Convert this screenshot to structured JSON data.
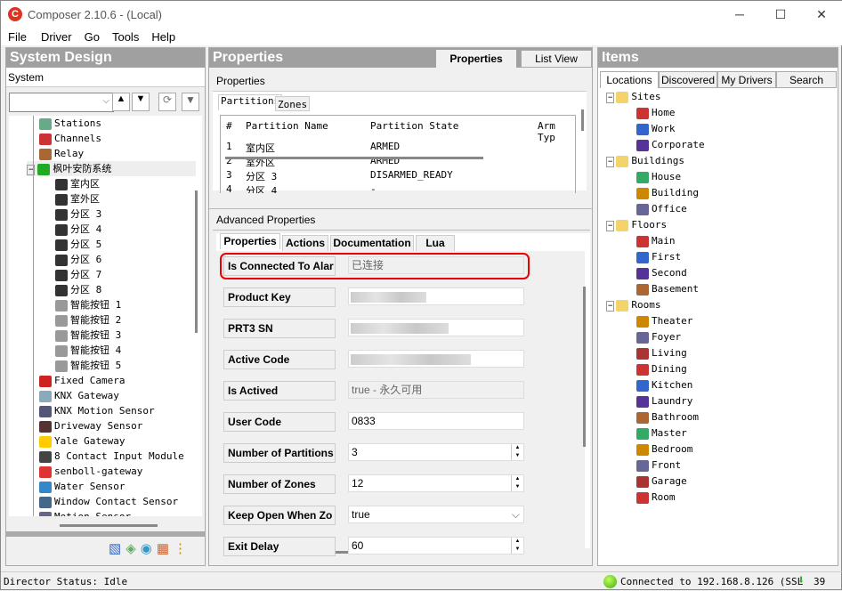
{
  "window": {
    "title": "Composer 2.10.6 - (Local)",
    "minimize": "─",
    "maximize": "☐",
    "close": "✕"
  },
  "menu": [
    "File",
    "Driver",
    "Go",
    "Tools",
    "Help"
  ],
  "left": {
    "title": "System Design",
    "subtitle": "System",
    "tree": [
      {
        "label": "Stations",
        "icon": "stations-icon",
        "color": "#6a8"
      },
      {
        "label": "Channels",
        "icon": "channels-icon",
        "color": "#c33"
      },
      {
        "label": "Relay",
        "icon": "relay-icon",
        "color": "#a63"
      },
      {
        "label": "枫叶安防系统",
        "icon": "panel-icon",
        "color": "#2a2"
      },
      {
        "label": "室内区",
        "icon": "partition-icon",
        "color": "#333"
      },
      {
        "label": "室外区",
        "icon": "partition-icon",
        "color": "#333"
      },
      {
        "label": "分区 3",
        "icon": "partition-icon",
        "color": "#333"
      },
      {
        "label": "分区 4",
        "icon": "partition-icon",
        "color": "#333"
      },
      {
        "label": "分区 5",
        "icon": "partition-icon",
        "color": "#333"
      },
      {
        "label": "分区 6",
        "icon": "partition-icon",
        "color": "#333"
      },
      {
        "label": "分区 7",
        "icon": "partition-icon",
        "color": "#333"
      },
      {
        "label": "分区 8",
        "icon": "partition-icon",
        "color": "#333"
      },
      {
        "label": "智能按钮 1",
        "icon": "button-icon",
        "color": "#999"
      },
      {
        "label": "智能按钮 2",
        "icon": "button-icon",
        "color": "#999"
      },
      {
        "label": "智能按钮 3",
        "icon": "button-icon",
        "color": "#999"
      },
      {
        "label": "智能按钮 4",
        "icon": "button-icon",
        "color": "#999"
      },
      {
        "label": "智能按钮 5",
        "icon": "button-icon",
        "color": "#999"
      },
      {
        "label": "Fixed Camera",
        "icon": "camera-icon",
        "color": "#c22"
      },
      {
        "label": "KNX Gateway",
        "icon": "knx-icon",
        "color": "#8ab"
      },
      {
        "label": "KNX Motion Sensor",
        "icon": "sensor-icon",
        "color": "#557"
      },
      {
        "label": "Driveway Sensor",
        "icon": "sensor-icon",
        "color": "#533"
      },
      {
        "label": "Yale Gateway",
        "icon": "yale-icon",
        "color": "#fc0"
      },
      {
        "label": "8 Contact Input Module",
        "icon": "module-icon",
        "color": "#444"
      },
      {
        "label": "senboll-gateway",
        "icon": "gateway-icon",
        "color": "#d33"
      },
      {
        "label": "Water Sensor",
        "icon": "water-icon",
        "color": "#38c"
      },
      {
        "label": "Window Contact Sensor",
        "icon": "window-icon",
        "color": "#468"
      },
      {
        "label": "Motion Sensor",
        "icon": "sensor-icon",
        "color": "#668"
      }
    ]
  },
  "middle": {
    "title": "Properties",
    "tabs": [
      "Properties",
      "List View"
    ],
    "section": "Properties",
    "subtabs": [
      "Partitions",
      "Zones"
    ],
    "columns": [
      "#",
      "Partition Name",
      "Partition State",
      "Arm Typ"
    ],
    "rows": [
      [
        "1",
        "室内区",
        "ARMED"
      ],
      [
        "2",
        "室外区",
        "ARMED"
      ],
      [
        "3",
        "分区 3",
        "DISARMED_READY"
      ],
      [
        "4",
        "分区 4",
        "-"
      ]
    ],
    "advanced": "Advanced Properties",
    "advtabs": [
      "Properties",
      "Actions",
      "Documentation",
      "Lua"
    ],
    "props": [
      {
        "label": "Is Connected To Alar",
        "value": "已连接",
        "type": "ro",
        "highlight": "#e00"
      },
      {
        "label": "Product Key",
        "value": "",
        "type": "blur"
      },
      {
        "label": "PRT3 SN",
        "value": "",
        "type": "blur"
      },
      {
        "label": "Active Code",
        "value": "",
        "type": "blur"
      },
      {
        "label": "Is Actived",
        "value": "true - 永久可用",
        "type": "ro"
      },
      {
        "label": "User Code",
        "value": "0833",
        "type": "text"
      },
      {
        "label": "Number of Partitions",
        "value": "3",
        "type": "spin"
      },
      {
        "label": "Number of Zones",
        "value": "12",
        "type": "spin"
      },
      {
        "label": "Keep Open When Zo",
        "value": "true",
        "type": "select"
      },
      {
        "label": "Exit Delay",
        "value": "60",
        "type": "spin"
      }
    ]
  },
  "right": {
    "title": "Items",
    "tabs": [
      "Locations",
      "Discovered",
      "My Drivers",
      "Search"
    ],
    "tree": [
      {
        "label": "Sites",
        "level": 0
      },
      {
        "label": "Home",
        "level": 1
      },
      {
        "label": "Work",
        "level": 1
      },
      {
        "label": "Corporate",
        "level": 1
      },
      {
        "label": "Buildings",
        "level": 0
      },
      {
        "label": "House",
        "level": 1
      },
      {
        "label": "Building",
        "level": 1
      },
      {
        "label": "Office",
        "level": 1
      },
      {
        "label": "Floors",
        "level": 0
      },
      {
        "label": "Main",
        "level": 1
      },
      {
        "label": "First",
        "level": 1
      },
      {
        "label": "Second",
        "level": 1
      },
      {
        "label": "Basement",
        "level": 1
      },
      {
        "label": "Rooms",
        "level": 0
      },
      {
        "label": "Theater",
        "level": 1
      },
      {
        "label": "Foyer",
        "level": 1
      },
      {
        "label": "Living",
        "level": 1
      },
      {
        "label": "Dining",
        "level": 1
      },
      {
        "label": "Kitchen",
        "level": 1
      },
      {
        "label": "Laundry",
        "level": 1
      },
      {
        "label": "Bathroom",
        "level": 1
      },
      {
        "label": "Master",
        "level": 1
      },
      {
        "label": "Bedroom",
        "level": 1
      },
      {
        "label": "Front",
        "level": 1
      },
      {
        "label": "Garage",
        "level": 1
      },
      {
        "label": "Room",
        "level": 1
      }
    ]
  },
  "status": {
    "left": "Director Status: Idle",
    "connection": "Connected to 192.168.8.126 (SSL",
    "count": "39"
  }
}
